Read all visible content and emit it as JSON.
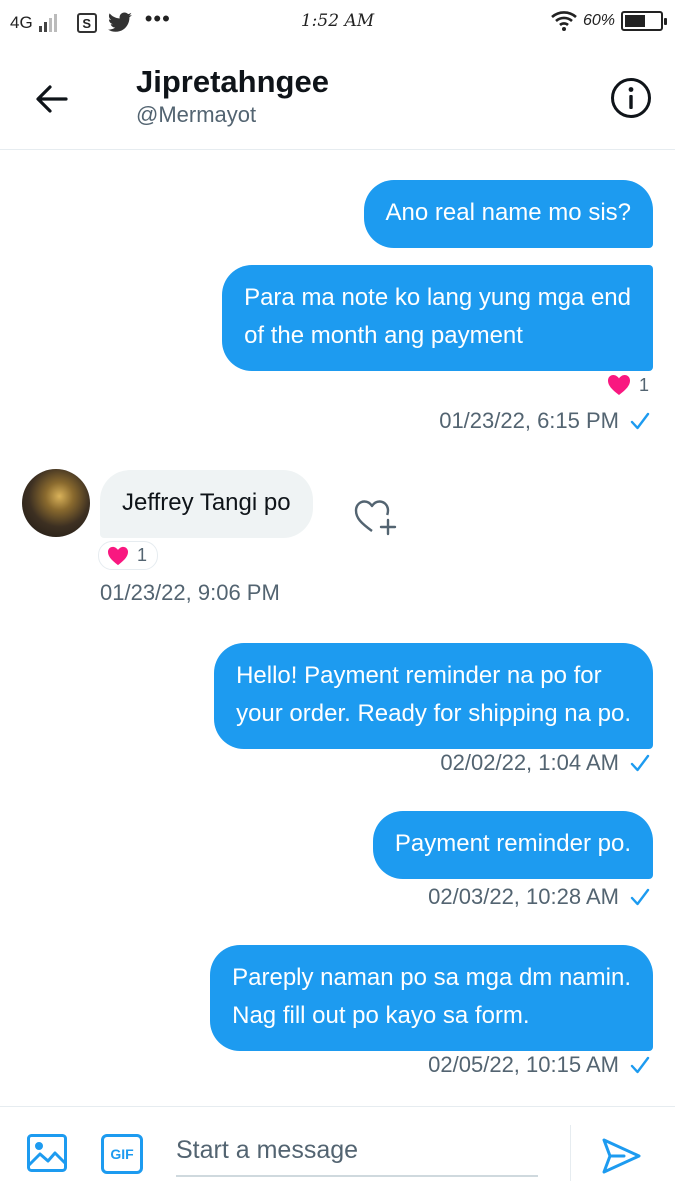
{
  "status_bar": {
    "network": "4G",
    "time": "1:52 AM",
    "battery": "60%",
    "battery_level": 0.6,
    "icons": [
      "signal-icon",
      "s-app-icon",
      "twitter-bird-icon",
      "more-dots-icon",
      "wifi-icon",
      "battery-icon"
    ]
  },
  "header": {
    "name": "Jipretahngee",
    "handle": "@Mermayot",
    "icons": [
      "back-arrow-icon",
      "info-icon"
    ]
  },
  "messages": [
    {
      "direction": "outgoing",
      "text": "Ano real name mo sis?"
    },
    {
      "direction": "outgoing",
      "line1": "Para ma note ko lang yung mga end",
      "line2": "of the month ang payment",
      "reaction_count": "1",
      "timestamp": "01/23/22, 6:15 PM"
    },
    {
      "direction": "incoming",
      "text": "Jeffrey Tangi po",
      "reaction_count": "1",
      "timestamp": "01/23/22, 9:06 PM"
    },
    {
      "direction": "outgoing",
      "line1": "Hello! Payment reminder na po for",
      "line2": "your order. Ready for shipping na po.",
      "timestamp": "02/02/22, 1:04 AM"
    },
    {
      "direction": "outgoing",
      "text": "Payment reminder po.",
      "timestamp": "02/03/22, 10:28 AM"
    },
    {
      "direction": "outgoing",
      "line1": "Pareply naman po sa mga dm namin.",
      "line2": "Nag fill out po kayo sa form.",
      "timestamp": "02/05/22, 10:15 AM"
    }
  ],
  "composer": {
    "placeholder": "Start a message",
    "gif_label": "GIF",
    "icons": [
      "image-icon",
      "gif-icon",
      "send-icon"
    ]
  },
  "colors": {
    "accent": "#1d9bf0",
    "heart": "#f91880",
    "incoming_bubble": "#eff3f4",
    "secondary_text": "#536471"
  }
}
